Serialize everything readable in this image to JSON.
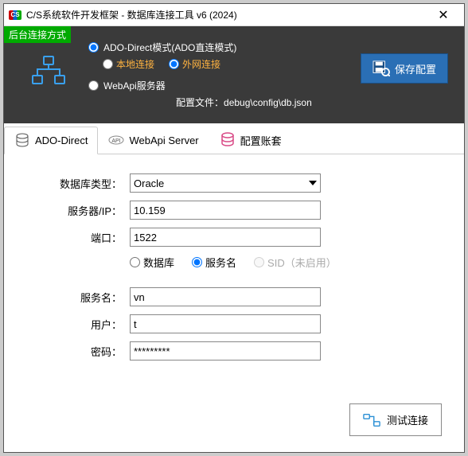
{
  "window": {
    "title": "C/S系统软件开发框架 - 数据库连接工具 v6 (2024)"
  },
  "badge": "后台连接方式",
  "mode": {
    "ado_label": "ADO-Direct模式(ADO直连模式)",
    "local": "本地连接",
    "external": "外网连接",
    "webapi": "WebApi服务器",
    "config_prefix": "配置文件：",
    "config_path": "debug\\config\\db.json"
  },
  "save_button": "保存配置",
  "tabs": {
    "ado": "ADO-Direct",
    "webapi": "WebApi Server",
    "account": "配置账套"
  },
  "form": {
    "db_type_label": "数据库类型：",
    "db_type_value": "Oracle",
    "server_label": "服务器/IP：",
    "server_value": "10.159",
    "port_label": "端口：",
    "port_value": "1522",
    "radio_db": "数据库",
    "radio_svc": "服务名",
    "radio_sid": "SID（未启用）",
    "svc_label": "服务名：",
    "svc_value": "vn",
    "user_label": "用户：",
    "user_value": "t",
    "pwd_label": "密码：",
    "pwd_value": "*********"
  },
  "test_button": "测试连接"
}
